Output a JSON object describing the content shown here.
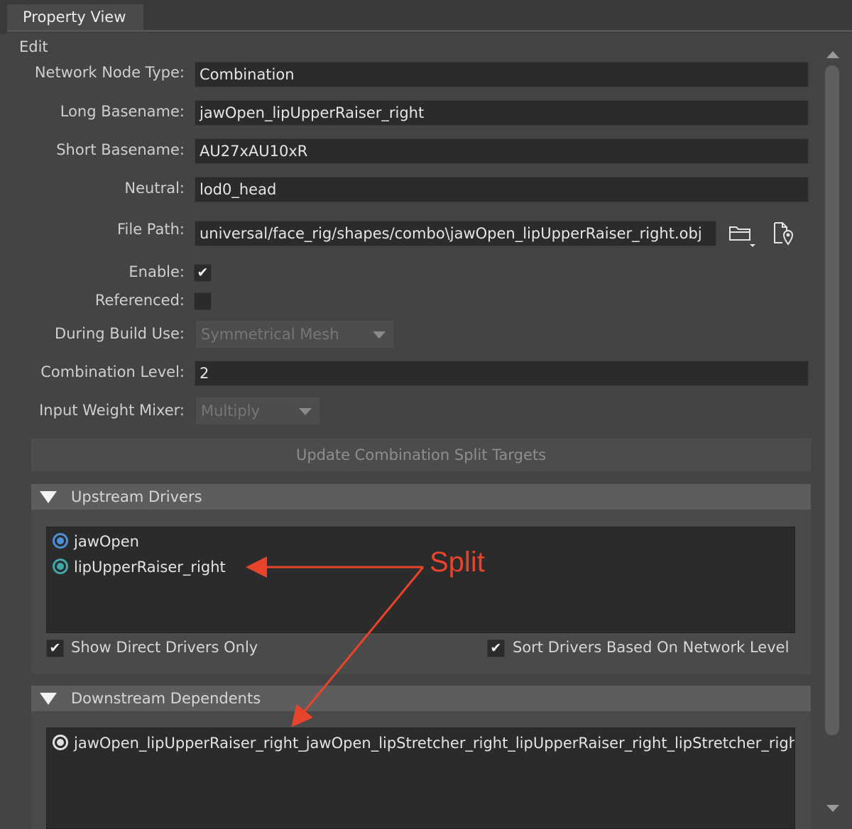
{
  "tab": {
    "title": "Property View"
  },
  "edit_label": "Edit",
  "fields": {
    "network_node_type": {
      "label": "Network Node Type:",
      "value": "Combination"
    },
    "long_basename": {
      "label": "Long Basename:",
      "value": "jawOpen_lipUpperRaiser_right"
    },
    "short_basename": {
      "label": "Short Basename:",
      "value": "AU27xAU10xR"
    },
    "neutral": {
      "label": "Neutral:",
      "value": "lod0_head"
    },
    "file_path": {
      "label": "File Path:",
      "value": "universal/face_rig/shapes/combo\\jawOpen_lipUpperRaiser_right.obj"
    },
    "enable": {
      "label": "Enable:",
      "checked": true
    },
    "referenced": {
      "label": "Referenced:",
      "checked": false
    },
    "during_build_use": {
      "label": "During Build Use:",
      "value": "Symmetrical Mesh"
    },
    "combination_level": {
      "label": "Combination Level:",
      "value": "2"
    },
    "input_weight_mixer": {
      "label": "Input Weight Mixer:",
      "value": "Multiply"
    }
  },
  "update_button": "Update Combination Split Targets",
  "upstream": {
    "header": "Upstream Drivers",
    "items": [
      {
        "label": "jawOpen",
        "ring_color": "#4a8fd8"
      },
      {
        "label": "lipUpperRaiser_right",
        "ring_color": "#3fa8a8"
      }
    ],
    "show_direct_label": "Show Direct Drivers Only",
    "show_direct_checked": true,
    "sort_label": "Sort Drivers Based On Network Level",
    "sort_checked": true
  },
  "downstream": {
    "header": "Downstream Dependents",
    "items": [
      {
        "label": "jawOpen_lipUpperRaiser_right_jawOpen_lipStretcher_right_lipUpperRaiser_right_lipStretcher_right",
        "ring_color": "#e0e0e0"
      }
    ]
  },
  "annotation": {
    "text": "Split",
    "color": "#e8432b"
  }
}
